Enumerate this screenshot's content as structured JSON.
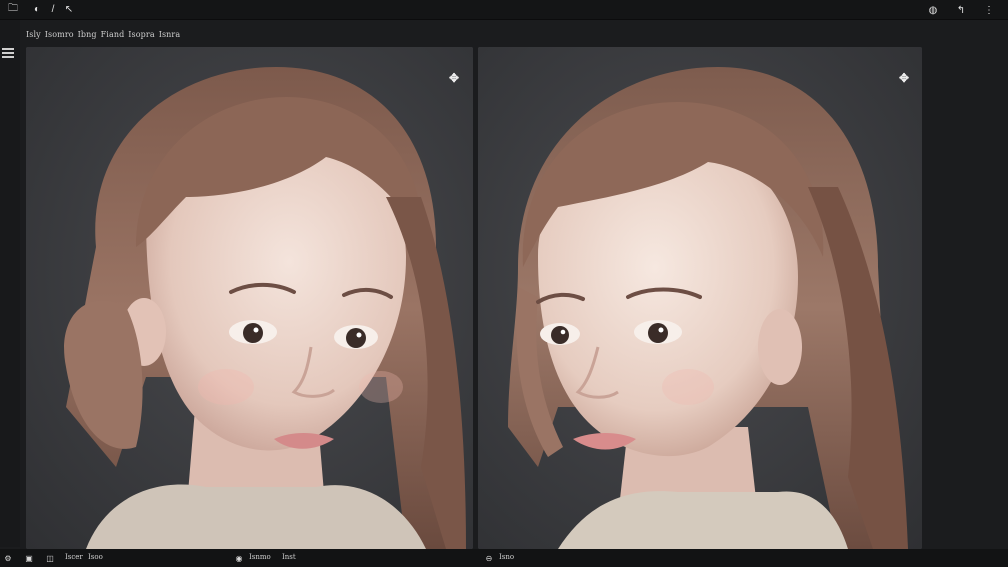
{
  "topbar": {
    "left_icons": [
      {
        "name": "folder-icon",
        "glyph": "🗀"
      },
      {
        "name": "settings-icon",
        "glyph": "◐"
      },
      {
        "name": "pen-icon",
        "glyph": "/"
      },
      {
        "name": "tool-icon",
        "glyph": "↖"
      }
    ],
    "right_icons": [
      {
        "name": "github-icon",
        "glyph": "◍"
      },
      {
        "name": "share-icon",
        "glyph": "↰"
      },
      {
        "name": "more-icon",
        "glyph": "⋮"
      }
    ]
  },
  "breadcrumb": [
    "Isly",
    "Isomro",
    "Ibng",
    "Fiand",
    "Isopra",
    "Isnra"
  ],
  "panels": [
    {
      "id": "left",
      "action_glyph": "✥"
    },
    {
      "id": "right",
      "action_glyph": "✥"
    }
  ],
  "bottombar": {
    "items_left": [
      "Iscer",
      "Isoo"
    ],
    "items_mid": [
      "Isnmo",
      "Inst"
    ],
    "items_right": [
      "Isno"
    ]
  },
  "colors": {
    "background": "#1b1c1e",
    "panel": "#3a3b3e",
    "hair": "#8a6858",
    "skin": "#ead6cc"
  }
}
